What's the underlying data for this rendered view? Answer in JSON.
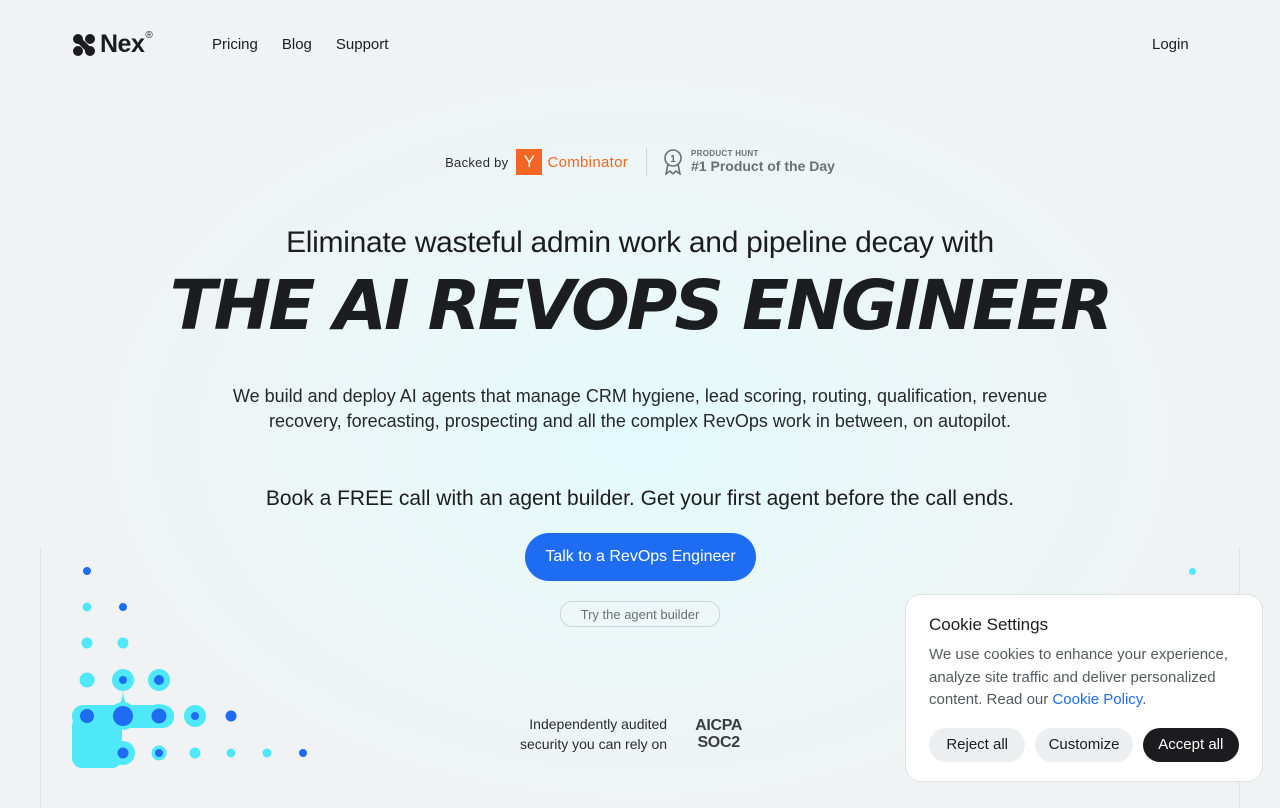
{
  "nav": {
    "logo_text": "Nex",
    "logo_mark": "®",
    "links": [
      {
        "label": "Pricing"
      },
      {
        "label": "Blog"
      },
      {
        "label": "Support"
      }
    ],
    "login_label": "Login"
  },
  "badges": {
    "backed_label": "Backed by",
    "yc_letter": "Y",
    "yc_name": "Combinator",
    "ph_icon_digit": "1",
    "ph_small": "PRODUCT HUNT",
    "ph_big": "#1 Product of the Day"
  },
  "hero": {
    "headline": "Eliminate wasteful admin work and pipeline decay with",
    "title": "THE AI REVOPS ENGINEER",
    "description": "We build and deploy AI agents that manage CRM hygiene, lead scoring, routing, qualification, revenue recovery, forecasting, prospecting and all the complex RevOps work in between, on autopilot.",
    "book_text": "Book a FREE call with an agent builder. Get your first agent before the call ends.",
    "cta_label": "Talk to a RevOps Engineer",
    "secondary_label": "Try the agent builder"
  },
  "security": {
    "line1": "Independently audited",
    "line2": "security you can rely on",
    "aicpa": "AICPA",
    "soc2": "SOC2"
  },
  "cookie": {
    "title": "Cookie Settings",
    "body": "We use cookies to enhance your experience, analyze site traffic and deliver personalized content. Read our ",
    "link": "Cookie Policy",
    "period": ".",
    "reject_label": "Reject all",
    "customize_label": "Customize",
    "accept_label": "Accept all"
  },
  "colors": {
    "accent": "#1e6cf2",
    "yc_orange": "#f26522",
    "cyan": "#4ee8f8",
    "dark": "#1c1c1e"
  }
}
